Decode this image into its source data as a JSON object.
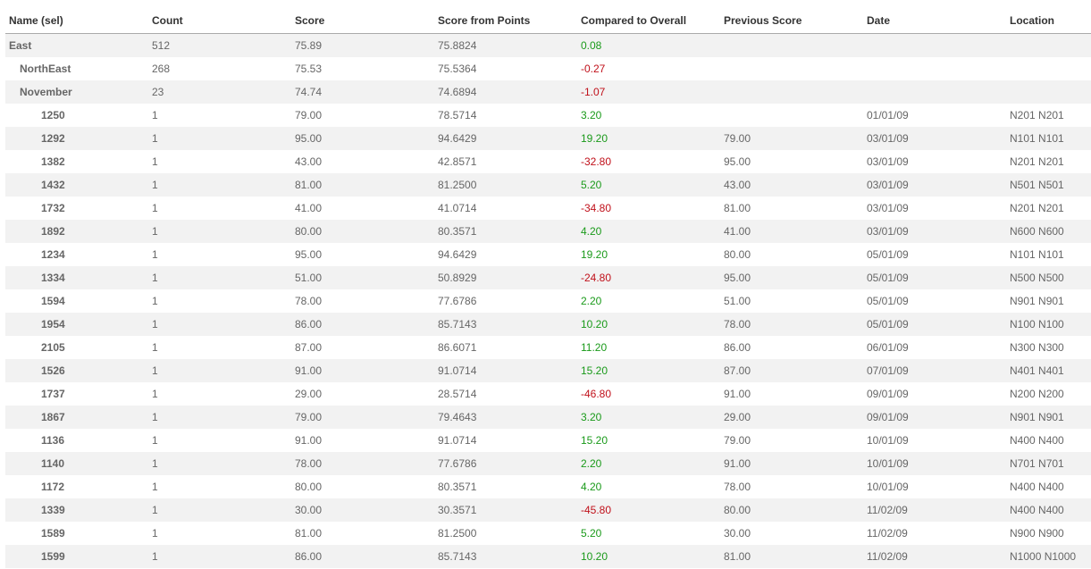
{
  "table": {
    "columns": [
      "Name (sel)",
      "Count",
      "Score",
      "Score from Points",
      "Compared to Overall",
      "Previous Score",
      "Date",
      "Location"
    ],
    "rows": [
      {
        "name": "East",
        "level": 0,
        "count": "512",
        "score": "75.89",
        "points": "75.8824",
        "compared": "0.08",
        "sign": "pos",
        "previous": "",
        "date": "",
        "location": ""
      },
      {
        "name": "NorthEast",
        "level": 1,
        "count": "268",
        "score": "75.53",
        "points": "75.5364",
        "compared": "-0.27",
        "sign": "neg",
        "previous": "",
        "date": "",
        "location": ""
      },
      {
        "name": "November",
        "level": 2,
        "count": "23",
        "score": "74.74",
        "points": "74.6894",
        "compared": "-1.07",
        "sign": "neg",
        "previous": "",
        "date": "",
        "location": ""
      },
      {
        "name": "1250",
        "level": 3,
        "count": "1",
        "score": "79.00",
        "points": "78.5714",
        "compared": "3.20",
        "sign": "pos",
        "previous": "",
        "date": "01/01/09",
        "location": "N201 N201"
      },
      {
        "name": "1292",
        "level": 3,
        "count": "1",
        "score": "95.00",
        "points": "94.6429",
        "compared": "19.20",
        "sign": "pos",
        "previous": "79.00",
        "date": "03/01/09",
        "location": "N101 N101"
      },
      {
        "name": "1382",
        "level": 3,
        "count": "1",
        "score": "43.00",
        "points": "42.8571",
        "compared": "-32.80",
        "sign": "neg",
        "previous": "95.00",
        "date": "03/01/09",
        "location": "N201 N201"
      },
      {
        "name": "1432",
        "level": 3,
        "count": "1",
        "score": "81.00",
        "points": "81.2500",
        "compared": "5.20",
        "sign": "pos",
        "previous": "43.00",
        "date": "03/01/09",
        "location": "N501 N501"
      },
      {
        "name": "1732",
        "level": 3,
        "count": "1",
        "score": "41.00",
        "points": "41.0714",
        "compared": "-34.80",
        "sign": "neg",
        "previous": "81.00",
        "date": "03/01/09",
        "location": "N201 N201"
      },
      {
        "name": "1892",
        "level": 3,
        "count": "1",
        "score": "80.00",
        "points": "80.3571",
        "compared": "4.20",
        "sign": "pos",
        "previous": "41.00",
        "date": "03/01/09",
        "location": "N600 N600"
      },
      {
        "name": "1234",
        "level": 3,
        "count": "1",
        "score": "95.00",
        "points": "94.6429",
        "compared": "19.20",
        "sign": "pos",
        "previous": "80.00",
        "date": "05/01/09",
        "location": "N101 N101"
      },
      {
        "name": "1334",
        "level": 3,
        "count": "1",
        "score": "51.00",
        "points": "50.8929",
        "compared": "-24.80",
        "sign": "neg",
        "previous": "95.00",
        "date": "05/01/09",
        "location": "N500 N500"
      },
      {
        "name": "1594",
        "level": 3,
        "count": "1",
        "score": "78.00",
        "points": "77.6786",
        "compared": "2.20",
        "sign": "pos",
        "previous": "51.00",
        "date": "05/01/09",
        "location": "N901 N901"
      },
      {
        "name": "1954",
        "level": 3,
        "count": "1",
        "score": "86.00",
        "points": "85.7143",
        "compared": "10.20",
        "sign": "pos",
        "previous": "78.00",
        "date": "05/01/09",
        "location": "N100 N100"
      },
      {
        "name": "2105",
        "level": 3,
        "count": "1",
        "score": "87.00",
        "points": "86.6071",
        "compared": "11.20",
        "sign": "pos",
        "previous": "86.00",
        "date": "06/01/09",
        "location": "N300 N300"
      },
      {
        "name": "1526",
        "level": 3,
        "count": "1",
        "score": "91.00",
        "points": "91.0714",
        "compared": "15.20",
        "sign": "pos",
        "previous": "87.00",
        "date": "07/01/09",
        "location": "N401 N401"
      },
      {
        "name": "1737",
        "level": 3,
        "count": "1",
        "score": "29.00",
        "points": "28.5714",
        "compared": "-46.80",
        "sign": "neg",
        "previous": "91.00",
        "date": "09/01/09",
        "location": "N200 N200"
      },
      {
        "name": "1867",
        "level": 3,
        "count": "1",
        "score": "79.00",
        "points": "79.4643",
        "compared": "3.20",
        "sign": "pos",
        "previous": "29.00",
        "date": "09/01/09",
        "location": "N901 N901"
      },
      {
        "name": "1136",
        "level": 3,
        "count": "1",
        "score": "91.00",
        "points": "91.0714",
        "compared": "15.20",
        "sign": "pos",
        "previous": "79.00",
        "date": "10/01/09",
        "location": "N400 N400"
      },
      {
        "name": "1140",
        "level": 3,
        "count": "1",
        "score": "78.00",
        "points": "77.6786",
        "compared": "2.20",
        "sign": "pos",
        "previous": "91.00",
        "date": "10/01/09",
        "location": "N701 N701"
      },
      {
        "name": "1172",
        "level": 3,
        "count": "1",
        "score": "80.00",
        "points": "80.3571",
        "compared": "4.20",
        "sign": "pos",
        "previous": "78.00",
        "date": "10/01/09",
        "location": "N400 N400"
      },
      {
        "name": "1339",
        "level": 3,
        "count": "1",
        "score": "30.00",
        "points": "30.3571",
        "compared": "-45.80",
        "sign": "neg",
        "previous": "80.00",
        "date": "11/02/09",
        "location": "N400 N400"
      },
      {
        "name": "1589",
        "level": 3,
        "count": "1",
        "score": "81.00",
        "points": "81.2500",
        "compared": "5.20",
        "sign": "pos",
        "previous": "30.00",
        "date": "11/02/09",
        "location": "N900 N900"
      },
      {
        "name": "1599",
        "level": 3,
        "count": "1",
        "score": "86.00",
        "points": "85.7143",
        "compared": "10.20",
        "sign": "pos",
        "previous": "81.00",
        "date": "11/02/09",
        "location": "N1000 N1000"
      }
    ]
  },
  "colors": {
    "positive": "#1a9a1a",
    "negative": "#c0101a",
    "alt_row": "#f2f2f2",
    "header_text": "#333333",
    "body_text": "#666666"
  }
}
